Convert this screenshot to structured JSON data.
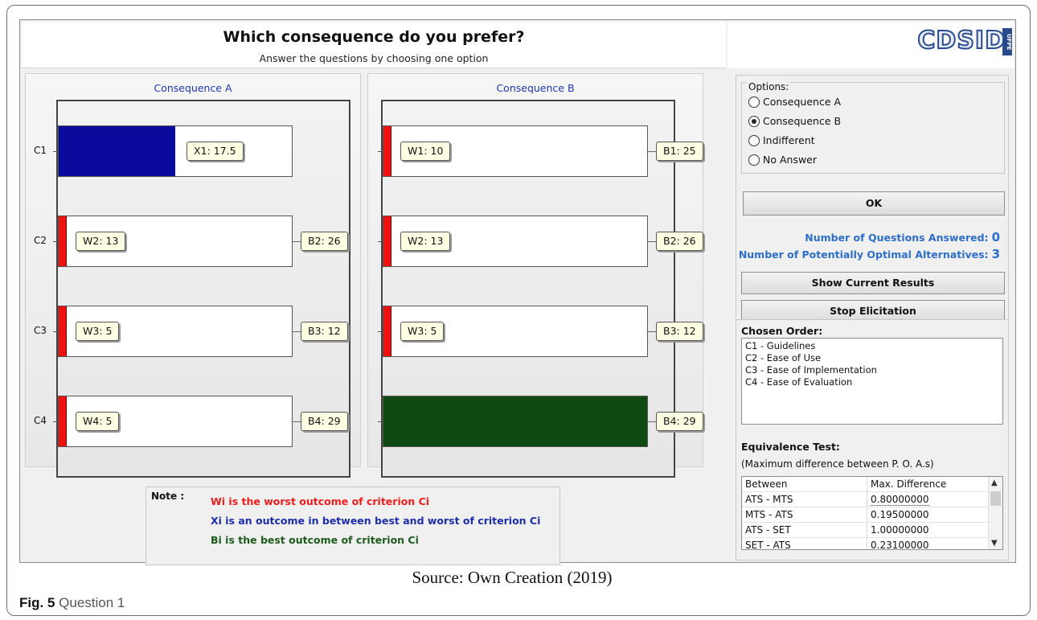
{
  "header": {
    "title": "Which consequence do you prefer?",
    "subtitle": "Answer the questions by choosing one option"
  },
  "logo": {
    "text": "CDSID",
    "side_text": "UFPE"
  },
  "consequence_a": {
    "title": "Consequence A",
    "rows": [
      {
        "axis": "C1",
        "fill": "blue",
        "fill_fraction": 0.5,
        "left_tag": "X1: 17.5",
        "right_tag": ""
      },
      {
        "axis": "C2",
        "fill": "red",
        "fill_fraction": 0.04,
        "left_tag": "W2: 13",
        "right_tag": "B2: 26"
      },
      {
        "axis": "C3",
        "fill": "red",
        "fill_fraction": 0.04,
        "left_tag": "W3: 5",
        "right_tag": "B3: 12"
      },
      {
        "axis": "C4",
        "fill": "red",
        "fill_fraction": 0.04,
        "left_tag": "W4: 5",
        "right_tag": "B4: 29"
      }
    ]
  },
  "consequence_b": {
    "title": "Consequence B",
    "rows": [
      {
        "axis": "",
        "fill": "red",
        "fill_fraction": 0.04,
        "left_tag": "W1: 10",
        "right_tag": "B1: 25"
      },
      {
        "axis": "",
        "fill": "red",
        "fill_fraction": 0.04,
        "left_tag": "W2: 13",
        "right_tag": "B2: 26"
      },
      {
        "axis": "",
        "fill": "red",
        "fill_fraction": 0.04,
        "left_tag": "W3: 5",
        "right_tag": "B3: 12"
      },
      {
        "axis": "",
        "fill": "green",
        "fill_fraction": 1.0,
        "left_tag": "",
        "right_tag": "B4: 29"
      }
    ]
  },
  "note": {
    "label": "Note :",
    "lines": [
      {
        "text": "Wi is the worst outcome of criterion Ci",
        "color": "#ee1c1c"
      },
      {
        "text": "Xi is an outcome in between best and worst of criterion Ci",
        "color": "#1d2fa8"
      },
      {
        "text": "Bi is the best outcome of criterion Ci",
        "color": "#1c5a1c"
      }
    ]
  },
  "options": {
    "legend": "Options:",
    "items": [
      {
        "label": "Consequence A",
        "checked": false
      },
      {
        "label": "Consequence B",
        "checked": true
      },
      {
        "label": "Indifferent",
        "checked": false
      },
      {
        "label": "No Answer",
        "checked": false
      }
    ],
    "ok_label": "OK"
  },
  "stats": {
    "answered_label": "Number of Questions Answered:",
    "answered_value": "0",
    "optimal_label": "Number of Potentially Optimal Alternatives:",
    "optimal_value": "3"
  },
  "buttons": {
    "show_results": "Show Current Results",
    "stop": "Stop Elicitation"
  },
  "chosen_order": {
    "title": "Chosen Order:",
    "items": [
      "C1 - Guidelines",
      "C2 - Ease of Use",
      "C3 - Ease of Implementation",
      "C4 - Ease of Evaluation"
    ]
  },
  "equivalence": {
    "title": "Equivalence Test:",
    "subtitle": "(Maximum difference between P. O. A.s)",
    "headers": [
      "Between",
      "Max. Difference"
    ],
    "rows": [
      [
        "ATS - MTS",
        "0.80000000"
      ],
      [
        "MTS - ATS",
        "0.19500000"
      ],
      [
        "ATS - SET",
        "1.00000000"
      ],
      [
        "SET - ATS",
        "0.23100000"
      ]
    ]
  },
  "caption": "Source: Own Creation (2019)",
  "figure": {
    "label": "Fig. 5",
    "title": "Question 1"
  },
  "colors": {
    "worst": "#ee1111",
    "between": "#0a0a9c",
    "best": "#0f4a12",
    "stat_blue": "#2d6fc7",
    "panel_title_blue": "#1d35b0"
  }
}
